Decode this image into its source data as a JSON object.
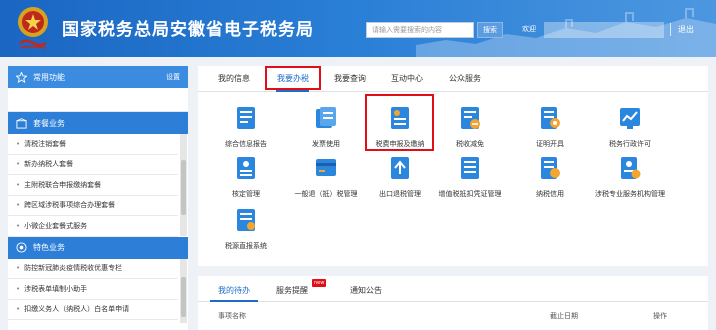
{
  "header": {
    "title": "国家税务总局安徽省电子税务局",
    "search_placeholder": "请输入需要搜索的内容",
    "search_button": "搜索",
    "welcome": "欢迎",
    "logout": "退出",
    "colors": {
      "brand": "#1a66c2",
      "highlight": "#e30d17"
    }
  },
  "sidebar": {
    "common_title": "常用功能",
    "settings": "设置",
    "package_title": "套餐业务",
    "package_items": [
      "清税注销套餐",
      "新办纳税人套餐",
      "主附税联合申报缴纳套餐",
      "跨区域涉税事项综合办理套餐",
      "小微企业套餐式服务"
    ],
    "special_title": "特色业务",
    "special_items": [
      "防控新冠肺炎疫情税收优惠专栏",
      "涉税表单填制小助手",
      "扣缴义务人（纳税人）白名单申请"
    ]
  },
  "main": {
    "tabs": [
      "我的信息",
      "我要办税",
      "我要查询",
      "互动中心",
      "公众服务"
    ],
    "active_tab": "我要办税",
    "services": [
      {
        "label": "综合信息报告",
        "icon": "document-list-icon"
      },
      {
        "label": "发票使用",
        "icon": "invoice-icon"
      },
      {
        "label": "税费申报及缴纳",
        "icon": "tax-declare-icon"
      },
      {
        "label": "税收减免",
        "icon": "tax-relief-icon"
      },
      {
        "label": "证明开具",
        "icon": "certificate-icon"
      },
      {
        "label": "税务行政许可",
        "icon": "license-chart-icon"
      },
      {
        "label": "核定管理",
        "icon": "approval-icon"
      },
      {
        "label": "一般退（抵）税管理",
        "icon": "refund-icon"
      },
      {
        "label": "出口退税管理",
        "icon": "export-refund-icon"
      },
      {
        "label": "增值税抵扣凭证管理",
        "icon": "vat-voucher-icon"
      },
      {
        "label": "纳税信用",
        "icon": "credit-icon"
      },
      {
        "label": "涉税专业服务机构管理",
        "icon": "agency-icon"
      },
      {
        "label": "税源直报系统",
        "icon": "direct-report-icon"
      }
    ]
  },
  "bottom": {
    "tabs": [
      "我的待办",
      "服务提醒",
      "通知公告"
    ],
    "badge": "new",
    "columns": [
      "事项名称",
      "截止日期",
      "操作"
    ]
  }
}
